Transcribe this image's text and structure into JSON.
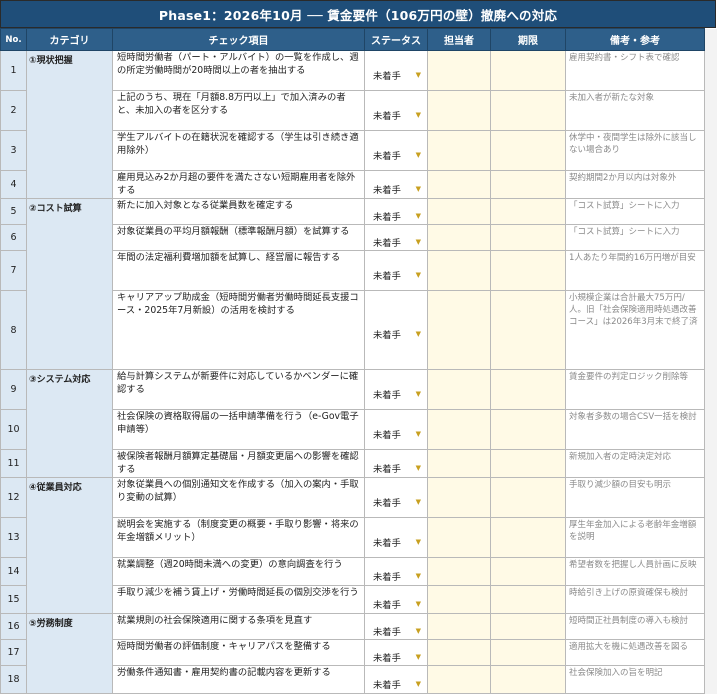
{
  "sheet": {
    "title": "Phase1：2026年10月 ── 賃金要件（106万円の壁）撤廃への対応",
    "headers": {
      "no": "No.",
      "category": "カテゴリ",
      "item": "チェック項目",
      "status": "ステータス",
      "assignee": "担当者",
      "deadline": "期限",
      "note": "備考・参考"
    },
    "categories": {
      "c1": "①現状把握",
      "c2": "②コスト試算",
      "c3": "③システム対応",
      "c4": "④従業員対応",
      "c5": "⑤労務制度"
    },
    "rows": [
      {
        "no": "1",
        "item": "短時間労働者（パート・アルバイト）の一覧を作成し、週の所定労働時間が20時間以上の者を抽出する",
        "status": "未着手",
        "note": "雇用契約書・シフト表で確認"
      },
      {
        "no": "2",
        "item": "上記のうち、現在「月額8.8万円以上」で加入済みの者と、未加入の者を区分する",
        "status": "未着手",
        "note": "未加入者が新たな対象"
      },
      {
        "no": "3",
        "item": "学生アルバイトの在籍状況を確認する（学生は引き続き適用除外）",
        "status": "未着手",
        "note": "休学中・夜間学生は除外に該当しない場合あり"
      },
      {
        "no": "4",
        "item": "雇用見込み2か月超の要件を満たさない短期雇用者を除外する",
        "status": "未着手",
        "note": "契約期間2か月以内は対象外"
      },
      {
        "no": "5",
        "item": "新たに加入対象となる従業員数を確定する",
        "status": "未着手",
        "note": "「コスト試算」シートに入力"
      },
      {
        "no": "6",
        "item": "対象従業員の平均月額報酬（標準報酬月額）を試算する",
        "status": "未着手",
        "note": "「コスト試算」シートに入力"
      },
      {
        "no": "7",
        "item": "年間の法定福利費増加額を試算し、経営層に報告する",
        "status": "未着手",
        "note": "1人あたり年間約16万円増が目安"
      },
      {
        "no": "8",
        "item": "キャリアアップ助成金（短時間労働者労働時間延長支援コース・2025年7月新設）の活用を検討する",
        "status": "未着手",
        "note": "小規模企業は合計最大75万円/人。旧「社会保険適用時処遇改善コース」は2026年3月末で終了済"
      },
      {
        "no": "9",
        "item": "給与計算システムが新要件に対応しているかベンダーに確認する",
        "status": "未着手",
        "note": "賃金要件の判定ロジック削除等"
      },
      {
        "no": "10",
        "item": "社会保険の資格取得届の一括申請準備を行う（e-Gov電子申請等）",
        "status": "未着手",
        "note": "対象者多数の場合CSV一括を検討"
      },
      {
        "no": "11",
        "item": "被保険者報酬月額算定基礎届・月額変更届への影響を確認する",
        "status": "未着手",
        "note": "新規加入者の定時決定対応"
      },
      {
        "no": "12",
        "item": "対象従業員への個別通知文を作成する（加入の案内・手取り変動の試算）",
        "status": "未着手",
        "note": "手取り減少額の目安も明示"
      },
      {
        "no": "13",
        "item": "説明会を実施する（制度変更の概要・手取り影響・将来の年金増額メリット）",
        "status": "未着手",
        "note": "厚生年金加入による老齢年金増額を説明"
      },
      {
        "no": "14",
        "item": "就業調整（週20時間未満への変更）の意向調査を行う",
        "status": "未着手",
        "note": "希望者数を把握し人員計画に反映"
      },
      {
        "no": "15",
        "item": "手取り減少を補う賃上げ・労働時間延長の個別交渉を行う",
        "status": "未着手",
        "note": "時給引き上げの原資確保も検討"
      },
      {
        "no": "16",
        "item": "就業規則の社会保険適用に関する条項を見直す",
        "status": "未着手",
        "note": "短時間正社員制度の導入も検討"
      },
      {
        "no": "17",
        "item": "短時間労働者の評価制度・キャリアパスを整備する",
        "status": "未着手",
        "note": "適用拡大を機に処遇改善を図る"
      },
      {
        "no": "18",
        "item": "労働条件通知書・雇用契約書の記載内容を更新する",
        "status": "未着手",
        "note": "社会保険加入の旨を明記"
      }
    ]
  }
}
